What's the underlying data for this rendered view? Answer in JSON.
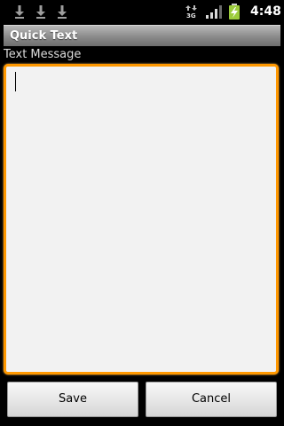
{
  "status_bar": {
    "time": "4:48",
    "icons": [
      "download-icon",
      "download-icon",
      "download-icon",
      "3g-data-icon",
      "signal-strength-icon",
      "battery-charging-icon"
    ],
    "accent_battery": "#9ccc3c"
  },
  "title_bar": {
    "title": "Quick Text"
  },
  "form": {
    "label": "Text Message",
    "message_value": "",
    "focus_color": "#ff9800"
  },
  "buttons": {
    "save_label": "Save",
    "cancel_label": "Cancel"
  }
}
